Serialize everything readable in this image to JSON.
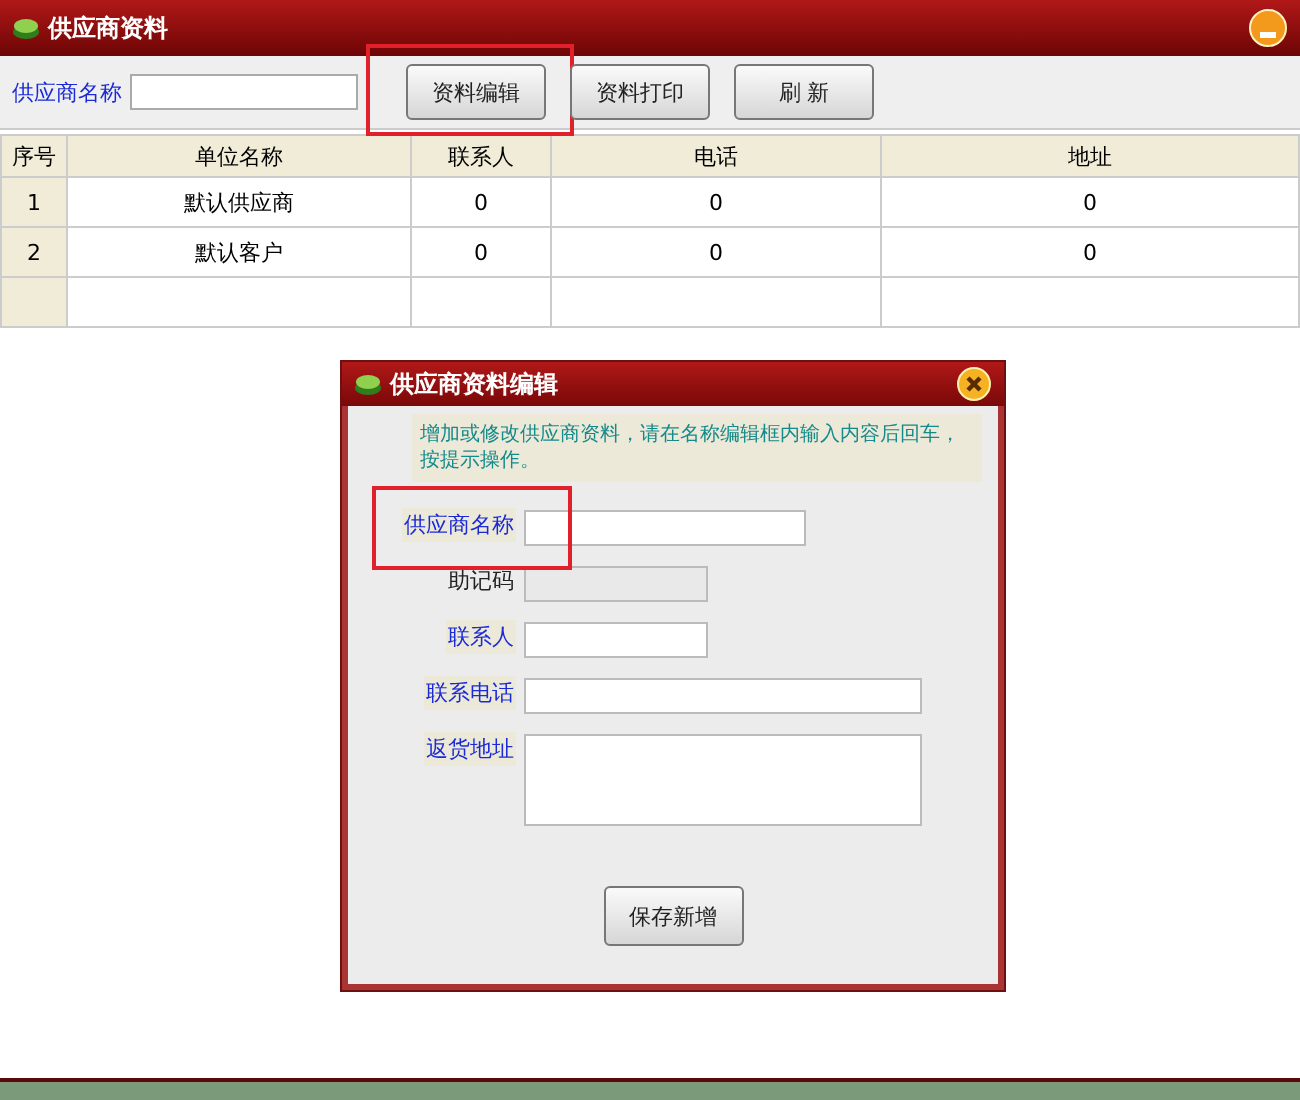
{
  "window": {
    "title": "供应商资料"
  },
  "toolbar": {
    "search_label": "供应商名称",
    "buttons": [
      {
        "label": "资料编辑",
        "highlighted": true
      },
      {
        "label": "资料打印",
        "highlighted": false
      },
      {
        "label": "刷 新",
        "highlighted": false
      }
    ]
  },
  "table": {
    "columns": [
      "序号",
      "单位名称",
      "联系人",
      "电话",
      "地址"
    ],
    "rows": [
      [
        "1",
        "默认供应商",
        "0",
        "0",
        "0"
      ],
      [
        "2",
        "默认客户",
        "0",
        "0",
        "0"
      ]
    ]
  },
  "dialog": {
    "title": "供应商资料编辑",
    "hint": "增加或修改供应商资料，请在名称编辑框内输入内容后回车，按提示操作。",
    "fields": [
      {
        "label": "供应商名称",
        "kind": "input",
        "disabled": false,
        "highlighted": true
      },
      {
        "label": "助记码",
        "kind": "input",
        "disabled": true,
        "highlighted": false
      },
      {
        "label": "联系人",
        "kind": "input",
        "disabled": false,
        "highlighted": false
      },
      {
        "label": "联系电话",
        "kind": "input",
        "disabled": false,
        "highlighted": false
      },
      {
        "label": "返货地址",
        "kind": "textarea",
        "disabled": false,
        "highlighted": false
      }
    ],
    "button": "保存新增"
  }
}
